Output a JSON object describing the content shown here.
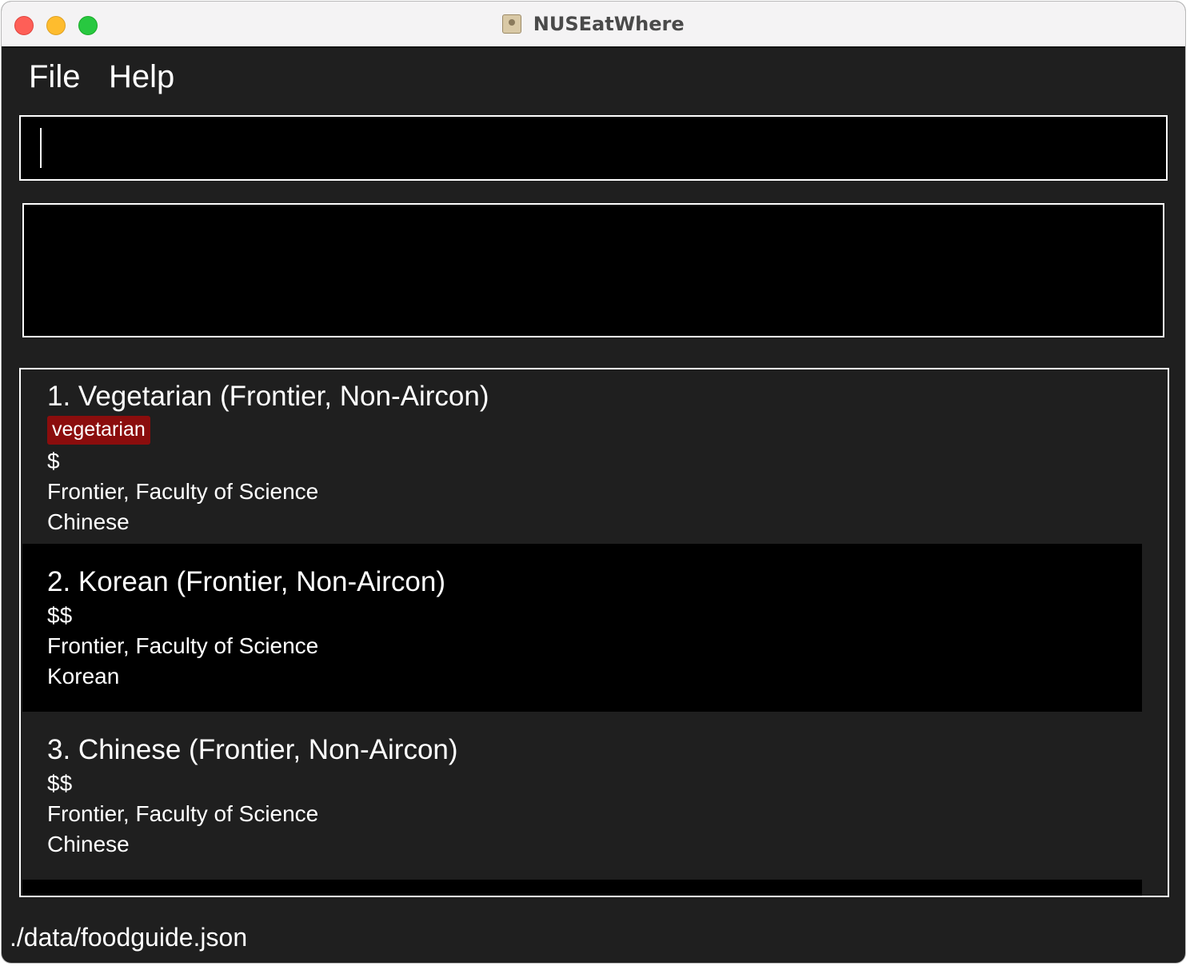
{
  "window": {
    "title": "NUSEatWhere"
  },
  "menu": {
    "file": "File",
    "help": "Help"
  },
  "command": {
    "value": ""
  },
  "result": {
    "text": ""
  },
  "eateries": [
    {
      "title": "1.  Vegetarian (Frontier, Non-Aircon)",
      "tag": "vegetarian",
      "price": "$",
      "location": "Frontier, Faculty of Science",
      "cuisine": "Chinese"
    },
    {
      "title": "2.  Korean (Frontier, Non-Aircon)",
      "price": "$$",
      "location": "Frontier, Faculty of Science",
      "cuisine": "Korean"
    },
    {
      "title": "3.  Chinese (Frontier, Non-Aircon)",
      "price": "$$",
      "location": "Frontier, Faculty of Science",
      "cuisine": "Chinese"
    }
  ],
  "status": {
    "file_path": "./data/foodguide.json"
  }
}
